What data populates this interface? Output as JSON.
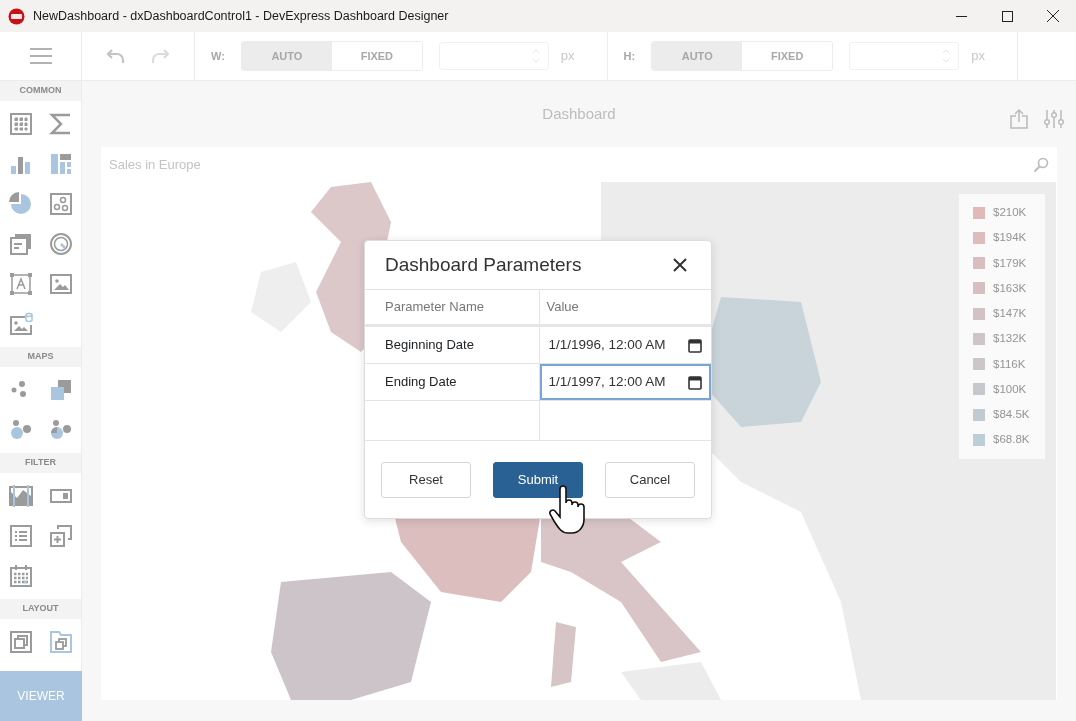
{
  "window": {
    "title": "NewDashboard - dxDashboardControl1 - DevExpress Dashboard Designer"
  },
  "toolbar": {
    "width": {
      "label": "W:",
      "unit": "px",
      "options": [
        {
          "label": "AUTO",
          "selected": true
        },
        {
          "label": "FIXED",
          "selected": false
        }
      ]
    },
    "height": {
      "label": "H:",
      "unit": "px",
      "options": [
        {
          "label": "AUTO",
          "selected": true
        },
        {
          "label": "FIXED",
          "selected": false
        }
      ]
    }
  },
  "sidebar": {
    "sections": [
      {
        "title": "COMMON"
      },
      {
        "title": "MAPS"
      },
      {
        "title": "FILTER"
      },
      {
        "title": "LAYOUT"
      }
    ],
    "viewer_button": "VIEWER"
  },
  "dashboard": {
    "title": "Dashboard",
    "item": {
      "title": "Sales in Europe",
      "legend": [
        {
          "label": "$210K",
          "color": "#e0b9b8"
        },
        {
          "label": "$194K",
          "color": "#dcbcbc"
        },
        {
          "label": "$179K",
          "color": "#d9bebf"
        },
        {
          "label": "$163K",
          "color": "#d5c0c1"
        },
        {
          "label": "$147K",
          "color": "#d2c2c4"
        },
        {
          "label": "$132K",
          "color": "#cfc4c7"
        },
        {
          "label": "$116K",
          "color": "#cbc6ca"
        },
        {
          "label": "$100K",
          "color": "#c7c8cd"
        },
        {
          "label": "$84.5K",
          "color": "#c2cbd1"
        },
        {
          "label": "$68.8K",
          "color": "#bccfd6"
        }
      ]
    }
  },
  "dialog": {
    "title": "Dashboard Parameters",
    "columns": [
      "Parameter Name",
      "Value"
    ],
    "rows": [
      {
        "name": "Beginning Date",
        "value": "1/1/1996, 12:00 AM",
        "focused": false
      },
      {
        "name": "Ending Date",
        "value": "1/1/1997, 12:00 AM",
        "focused": true
      }
    ],
    "buttons": [
      {
        "label": "Reset",
        "primary": false
      },
      {
        "label": "Submit",
        "primary": true
      },
      {
        "label": "Cancel",
        "primary": false
      }
    ]
  }
}
